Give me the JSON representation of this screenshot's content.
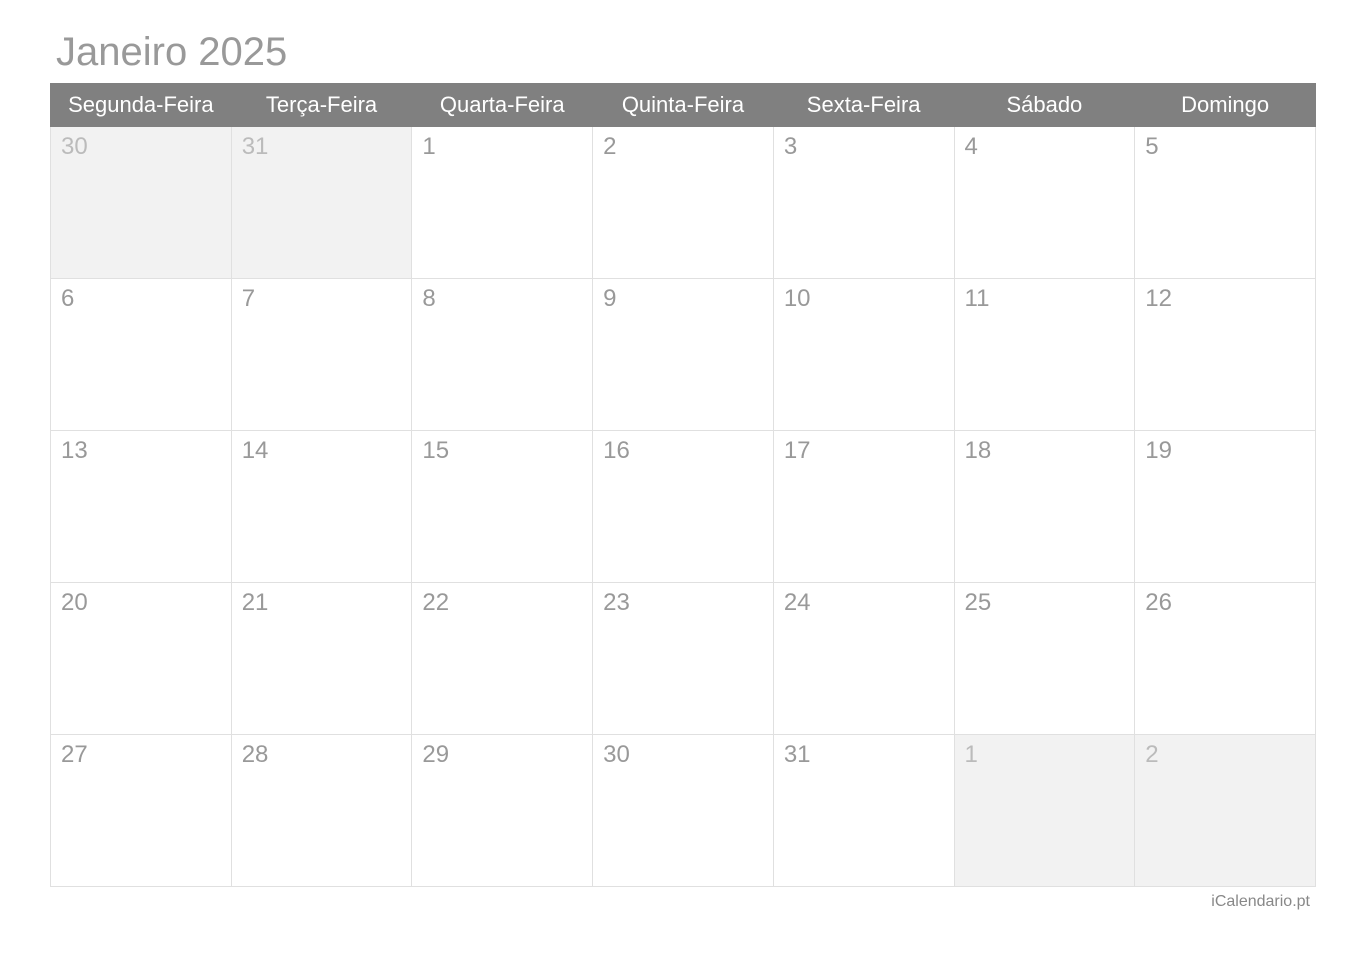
{
  "title": "Janeiro 2025",
  "footer": "iCalendario.pt",
  "weekdays": [
    "Segunda-Feira",
    "Terça-Feira",
    "Quarta-Feira",
    "Quinta-Feira",
    "Sexta-Feira",
    "Sábado",
    "Domingo"
  ],
  "weeks": [
    [
      {
        "day": "30",
        "other": true
      },
      {
        "day": "31",
        "other": true
      },
      {
        "day": "1",
        "other": false
      },
      {
        "day": "2",
        "other": false
      },
      {
        "day": "3",
        "other": false
      },
      {
        "day": "4",
        "other": false
      },
      {
        "day": "5",
        "other": false
      }
    ],
    [
      {
        "day": "6",
        "other": false
      },
      {
        "day": "7",
        "other": false
      },
      {
        "day": "8",
        "other": false
      },
      {
        "day": "9",
        "other": false
      },
      {
        "day": "10",
        "other": false
      },
      {
        "day": "11",
        "other": false
      },
      {
        "day": "12",
        "other": false
      }
    ],
    [
      {
        "day": "13",
        "other": false
      },
      {
        "day": "14",
        "other": false
      },
      {
        "day": "15",
        "other": false
      },
      {
        "day": "16",
        "other": false
      },
      {
        "day": "17",
        "other": false
      },
      {
        "day": "18",
        "other": false
      },
      {
        "day": "19",
        "other": false
      }
    ],
    [
      {
        "day": "20",
        "other": false
      },
      {
        "day": "21",
        "other": false
      },
      {
        "day": "22",
        "other": false
      },
      {
        "day": "23",
        "other": false
      },
      {
        "day": "24",
        "other": false
      },
      {
        "day": "25",
        "other": false
      },
      {
        "day": "26",
        "other": false
      }
    ],
    [
      {
        "day": "27",
        "other": false
      },
      {
        "day": "28",
        "other": false
      },
      {
        "day": "29",
        "other": false
      },
      {
        "day": "30",
        "other": false
      },
      {
        "day": "31",
        "other": false
      },
      {
        "day": "1",
        "other": true
      },
      {
        "day": "2",
        "other": true
      }
    ]
  ]
}
